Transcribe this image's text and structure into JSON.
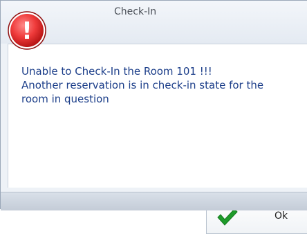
{
  "dialog": {
    "title": "Check-In",
    "icon": "error-icon",
    "icon_glyph": "!",
    "message_lines": [
      "Unable to Check-In the Room 101 !!!",
      "Another reservation is in check-in state for the",
      "room in question"
    ],
    "ok_label": "Ok",
    "ok_icon": "checkmark-icon"
  },
  "colors": {
    "message_text": "#1d3f8a",
    "error_red": "#e53a3a",
    "check_green": "#1e9b2a"
  }
}
